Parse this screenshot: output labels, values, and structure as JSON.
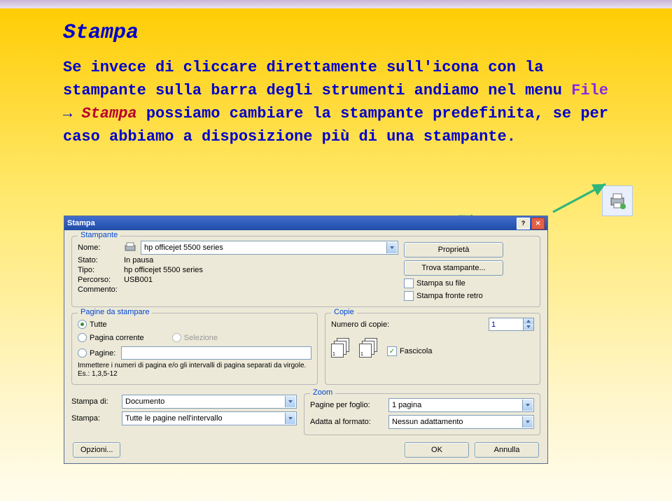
{
  "slide": {
    "title": "Stampa",
    "text_prefix": "Se invece di cliccare direttamente sull'icona con la stampante sulla barra degli strumenti andiamo nel menu ",
    "file_word": "File",
    "arrow_word": " → ",
    "stampa_word": "Stampa",
    "text_suffix": " possiamo cambiare la stampante predefinita, se per caso abbiamo a disposizione più di una stampante."
  },
  "dialog": {
    "title": "Stampa",
    "printer": {
      "legend": "Stampante",
      "name_lbl": "Nome:",
      "name_val": "hp officejet 5500 series",
      "status_lbl": "Stato:",
      "status_val": "In pausa",
      "type_lbl": "Tipo:",
      "type_val": "hp officejet 5500 series",
      "path_lbl": "Percorso:",
      "path_val": "USB001",
      "comment_lbl": "Commento:",
      "btn_props": "Proprietà",
      "btn_find": "Trova stampante...",
      "chk_file": "Stampa su file",
      "chk_duplex": "Stampa fronte retro"
    },
    "pages": {
      "legend": "Pagine da stampare",
      "r_all": "Tutte",
      "r_current": "Pagina corrente",
      "r_sel": "Selezione",
      "r_pages": "Pagine:",
      "hint": "Immettere i numeri di pagina e/o gli intervalli di pagina separati da virgole. Es.: 1,3,5-12"
    },
    "copies": {
      "legend": "Copie",
      "num_lbl": "Numero di copie:",
      "num_val": "1",
      "collate": "Fascicola"
    },
    "bottom": {
      "print_what_lbl": "Stampa di:",
      "print_what_val": "Documento",
      "print_range_lbl": "Stampa:",
      "print_range_val": "Tutte le pagine nell'intervallo",
      "zoom_legend": "Zoom",
      "per_sheet_lbl": "Pagine per foglio:",
      "per_sheet_val": "1 pagina",
      "scale_lbl": "Adatta al formato:",
      "scale_val": "Nessun adattamento"
    },
    "footer": {
      "options": "Opzioni...",
      "ok": "OK",
      "cancel": "Annulla"
    }
  }
}
